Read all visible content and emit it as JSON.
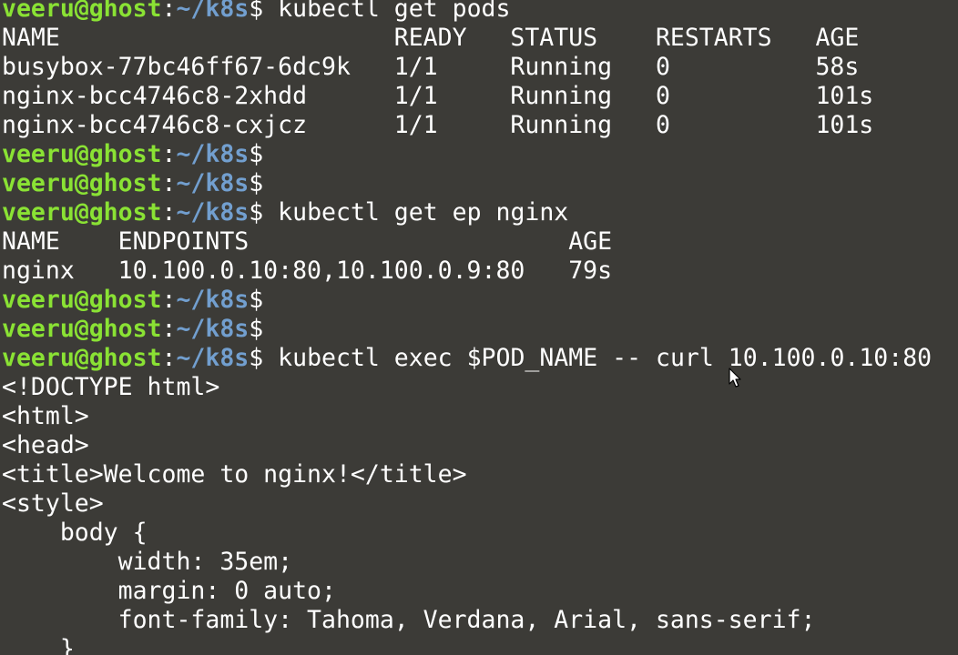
{
  "terminal": {
    "prompt": {
      "user_host": "veeru@ghost",
      "colon": ":",
      "path": "~/k8s",
      "dollar": "$"
    },
    "lines": [
      {
        "type": "prompt",
        "command": " kubectl get pods"
      },
      {
        "type": "output",
        "text": "NAME                       READY   STATUS    RESTARTS   AGE"
      },
      {
        "type": "output",
        "text": "busybox-77bc46ff67-6dc9k   1/1     Running   0          58s"
      },
      {
        "type": "output",
        "text": "nginx-bcc4746c8-2xhdd      1/1     Running   0          101s"
      },
      {
        "type": "output",
        "text": "nginx-bcc4746c8-cxjcz      1/1     Running   0          101s"
      },
      {
        "type": "prompt",
        "command": ""
      },
      {
        "type": "prompt",
        "command": ""
      },
      {
        "type": "prompt",
        "command": " kubectl get ep nginx"
      },
      {
        "type": "output",
        "text": "NAME    ENDPOINTS                      AGE"
      },
      {
        "type": "output",
        "text": "nginx   10.100.0.10:80,10.100.0.9:80   79s"
      },
      {
        "type": "prompt",
        "command": ""
      },
      {
        "type": "prompt",
        "command": ""
      },
      {
        "type": "prompt",
        "command": " kubectl exec $POD_NAME -- curl 10.100.0.10:80"
      },
      {
        "type": "output",
        "text": "<!DOCTYPE html>"
      },
      {
        "type": "output",
        "text": "<html>"
      },
      {
        "type": "output",
        "text": "<head>"
      },
      {
        "type": "output",
        "text": "<title>Welcome to nginx!</title>"
      },
      {
        "type": "output",
        "text": "<style>"
      },
      {
        "type": "output",
        "text": "    body {"
      },
      {
        "type": "output",
        "text": "        width: 35em;"
      },
      {
        "type": "output",
        "text": "        margin: 0 auto;"
      },
      {
        "type": "output",
        "text": "        font-family: Tahoma, Verdana, Arial, sans-serif;"
      },
      {
        "type": "output",
        "text": "    }"
      }
    ]
  },
  "colors": {
    "background": "#3c3b37",
    "user_host": "#8ae234",
    "path": "#729fcf",
    "text": "#ffffff"
  },
  "icons": {
    "mouse_cursor": "arrow-pointer-icon"
  }
}
